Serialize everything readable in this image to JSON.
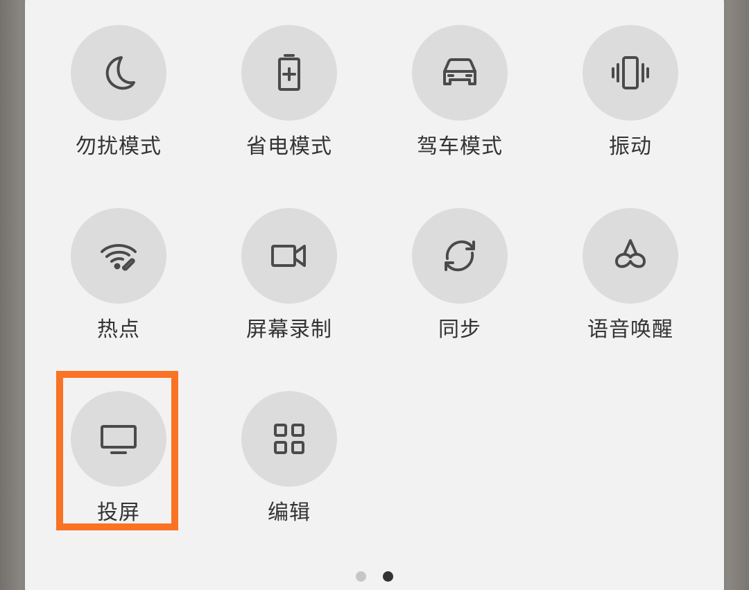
{
  "tiles": [
    {
      "label": "勿扰模式",
      "icon": "moon-icon"
    },
    {
      "label": "省电模式",
      "icon": "battery-plus-icon"
    },
    {
      "label": "驾车模式",
      "icon": "car-icon"
    },
    {
      "label": "振动",
      "icon": "vibrate-icon"
    },
    {
      "label": "热点",
      "icon": "hotspot-icon"
    },
    {
      "label": "屏幕录制",
      "icon": "video-camera-icon"
    },
    {
      "label": "同步",
      "icon": "sync-icon"
    },
    {
      "label": "语音唤醒",
      "icon": "voice-wake-icon"
    },
    {
      "label": "投屏",
      "icon": "monitor-icon"
    },
    {
      "label": "编辑",
      "icon": "grid-icon"
    }
  ],
  "pagination": {
    "total": 2,
    "active": 2
  },
  "colors": {
    "panel": "#f2f2f2",
    "tile": "#dcdcdc",
    "icon": "#4a4a4a",
    "highlight": "#fa7223",
    "dot_active": "#333333",
    "dot_inactive": "#c6c6c6"
  }
}
